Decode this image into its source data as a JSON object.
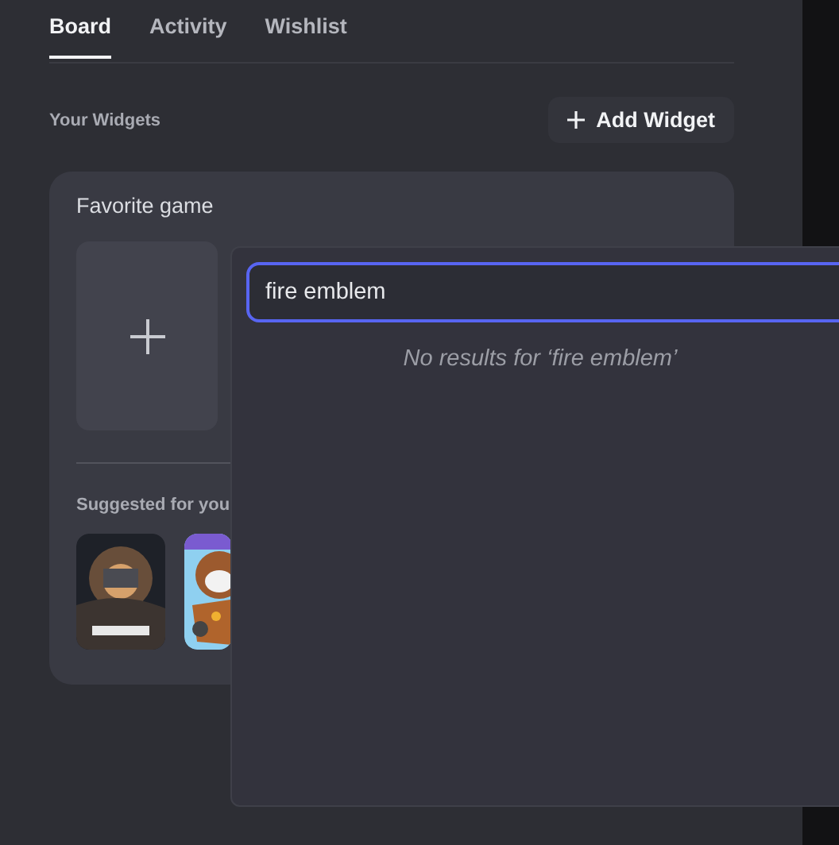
{
  "tabs": [
    {
      "label": "Board",
      "selected": true
    },
    {
      "label": "Activity",
      "selected": false
    },
    {
      "label": "Wishlist",
      "selected": false
    }
  ],
  "widgets": {
    "title": "Your Widgets",
    "add_button": "Add Widget"
  },
  "card": {
    "title": "Favorite game",
    "suggested_title": "Suggested for you"
  },
  "search_popup": {
    "value": "fire emblem",
    "empty_message": "No results for ‘fire emblem’"
  }
}
